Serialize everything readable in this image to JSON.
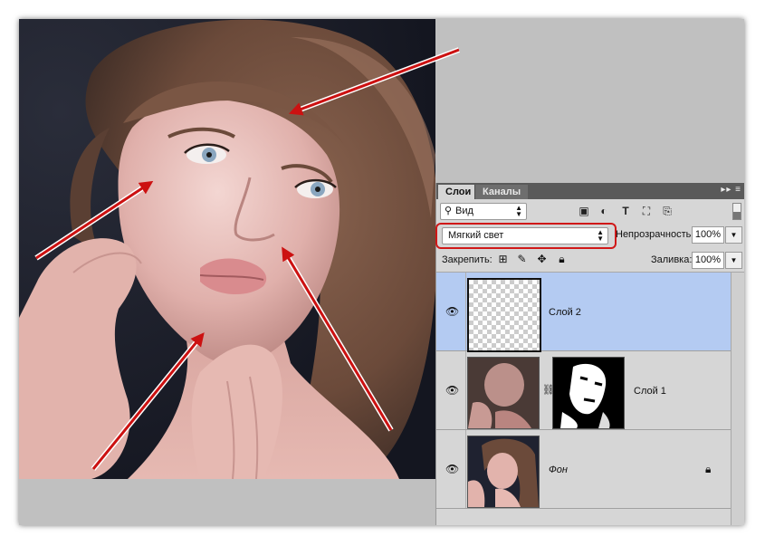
{
  "layers_panel": {
    "tabs": [
      {
        "label": "Слои"
      },
      {
        "label": "Каналы"
      }
    ],
    "panel_menu_icon": "panel-menu-icon",
    "filter": {
      "label": "Вид",
      "icon": "search-icon"
    },
    "filter_icons": [
      "image-filter-icon",
      "adjustment-filter-icon",
      "type-filter-icon",
      "shape-filter-icon",
      "smart-object-filter-icon"
    ],
    "blend_mode": {
      "value": "Мягкий свет",
      "highlight_color": "#d01818"
    },
    "opacity": {
      "label": "Непрозрачность:",
      "value": "100%"
    },
    "lock": {
      "label": "Закрепить:",
      "icons": [
        "lock-transparent-icon",
        "lock-brush-icon",
        "lock-position-icon",
        "lock-all-icon"
      ]
    },
    "fill": {
      "label": "Заливка:",
      "value": "100%"
    },
    "layers": [
      {
        "name": "Слой 2",
        "selected": true,
        "selection_color": "#b4cbf2"
      },
      {
        "name": "Слой 1",
        "has_mask": true
      },
      {
        "name": "Фон",
        "locked": true
      }
    ]
  },
  "annotations": {
    "arrow_color": "#cc1111",
    "arrow_count": 5
  }
}
